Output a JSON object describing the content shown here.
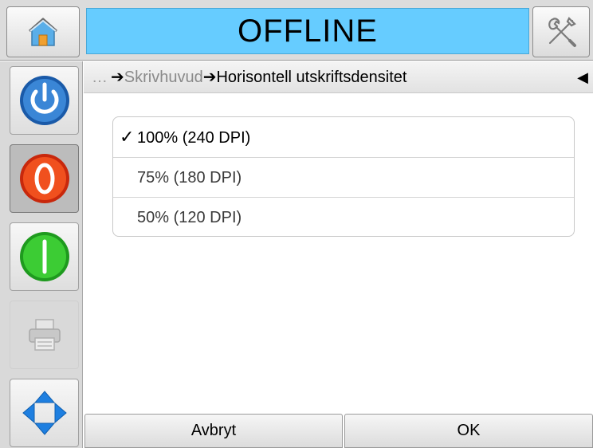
{
  "header": {
    "status": "OFFLINE",
    "status_color": "#66ccff"
  },
  "icons": {
    "home": "home-icon",
    "tools": "tools-icon",
    "power": "power-icon",
    "stop": "stop-icon",
    "start": "start-icon",
    "print": "printer-icon",
    "navigate": "navigate-arrows-icon"
  },
  "breadcrumb": {
    "ellipsis": "…",
    "arrow": "➔",
    "parent": "Skrivhuvud",
    "current": "Horisontell utskriftsdensitet",
    "back_glyph": "◀"
  },
  "options": [
    {
      "label": "100% (240 DPI)",
      "selected": true,
      "check": "✓"
    },
    {
      "label": "75% (180 DPI)",
      "selected": false
    },
    {
      "label": "50% (120 DPI)",
      "selected": false
    }
  ],
  "footer": {
    "cancel_label": "Avbryt",
    "ok_label": "OK"
  }
}
